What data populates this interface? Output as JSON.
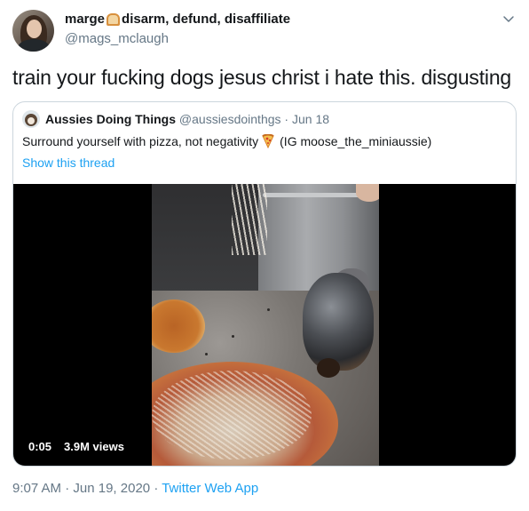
{
  "author": {
    "name_part1": "marge",
    "name_part2": "disarm, defund, disaffiliate",
    "handle": "@mags_mclaugh"
  },
  "tweet_text": "train your fucking dogs jesus christ i hate this. disgusting",
  "quoted": {
    "name": "Aussies Doing Things",
    "handle": "@aussiesdointhgs",
    "separator": "·",
    "date": "Jun 18",
    "text_before_emoji": "Surround yourself with pizza, not negativity",
    "text_after_emoji": "(IG moose_the_miniaussie)",
    "show_thread": "Show this thread",
    "video": {
      "time": "0:05",
      "views": "3.9M views"
    }
  },
  "footer": {
    "time": "9:07 AM",
    "sep1": "·",
    "date": "Jun 19, 2020",
    "sep2": "·",
    "app": "Twitter Web App"
  },
  "icons": {
    "more": "chevron-down-icon",
    "name_emoji": "bread-icon",
    "pizza": "pizza-icon"
  },
  "colors": {
    "link": "#1da1f2",
    "secondary_text": "#657786",
    "primary_text": "#14171a",
    "border": "#ccd6dd"
  }
}
